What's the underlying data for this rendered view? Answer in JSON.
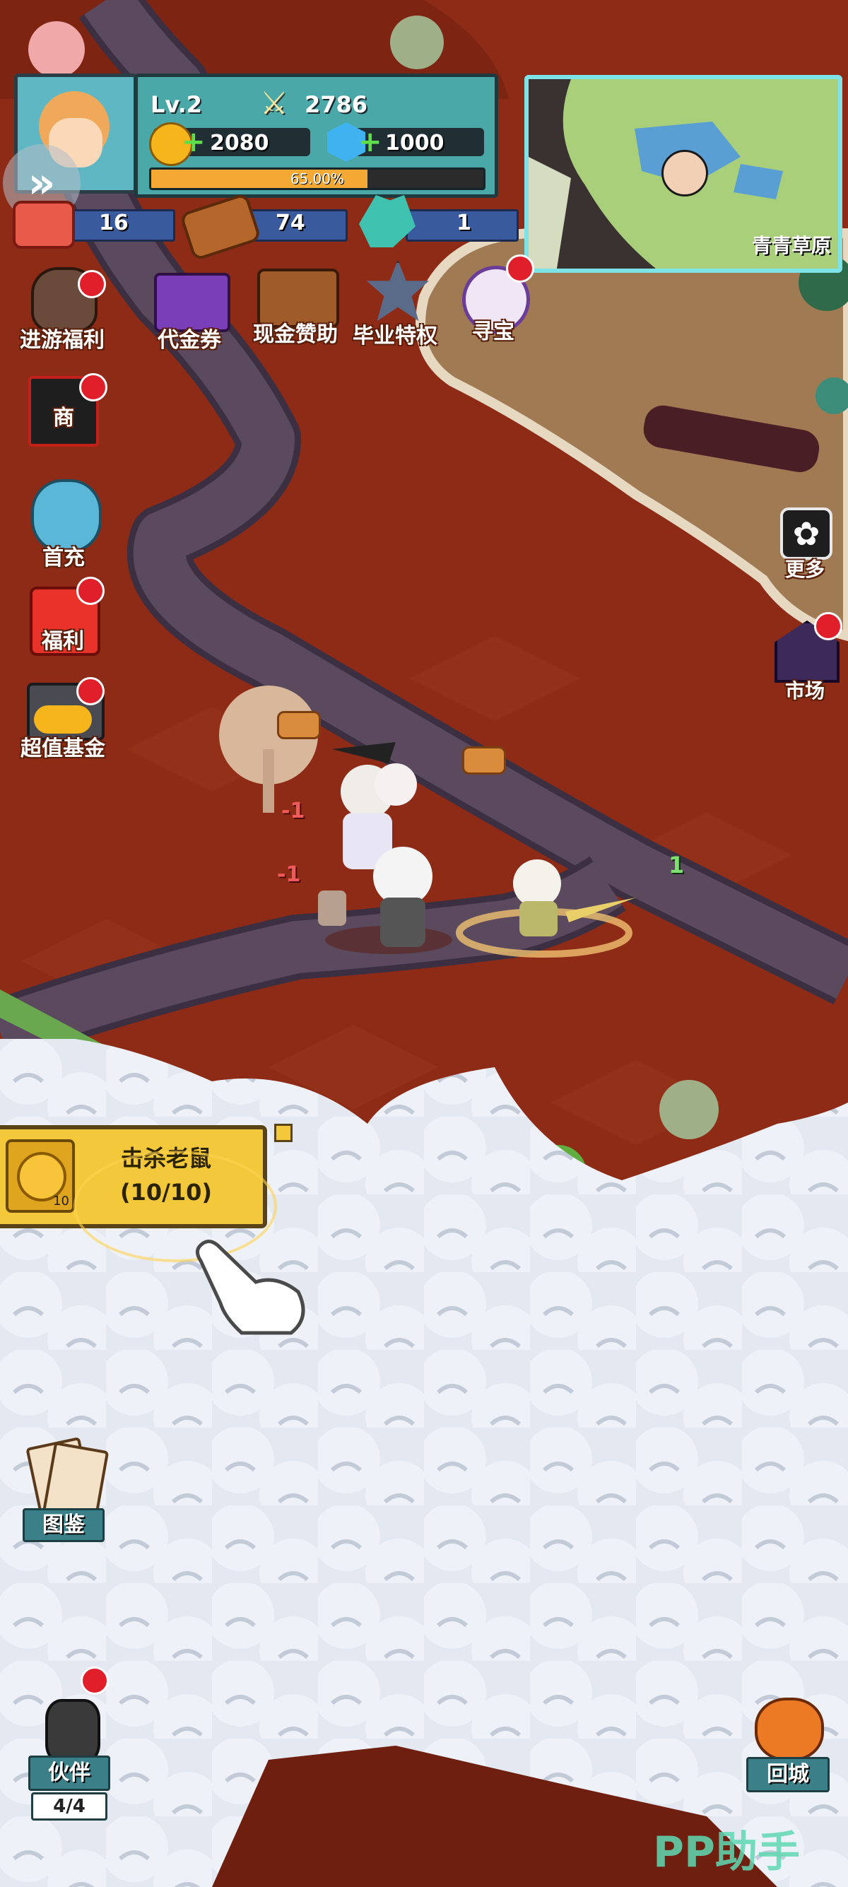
{
  "player": {
    "level": "Lv.2",
    "combat_power": "2786",
    "gold": "2080",
    "gems": "1000",
    "exp_percent_label": "65.00%",
    "exp_fraction": 0.65
  },
  "resources": {
    "stone": "16",
    "wood": "74",
    "crystal": "1"
  },
  "minimap": {
    "area_name": "青青草原"
  },
  "top_menu": [
    {
      "label": "代金券",
      "icon": "voucher-gems-icon"
    },
    {
      "label": "现金赞助",
      "icon": "treasure-chest-icon"
    },
    {
      "label": "毕业特权",
      "icon": "graduation-badge-icon"
    },
    {
      "label": "寻宝",
      "icon": "treasure-hunt-wheel-icon"
    }
  ],
  "left_menu": [
    {
      "label": "进游福利",
      "icon": "lucky-bag-icon"
    },
    {
      "label": "商",
      "icon": "gift-box-icon"
    },
    {
      "label": "首充",
      "icon": "first-recharge-hero-icon"
    },
    {
      "label": "福利",
      "icon": "red-envelope-icon"
    },
    {
      "label": "超值基金",
      "icon": "gold-coins-chest-icon"
    }
  ],
  "right_menu": [
    {
      "label": "更多",
      "icon": "more-gear-icon"
    },
    {
      "label": "市场",
      "icon": "market-house-icon"
    }
  ],
  "quest": {
    "title": "击杀老鼠",
    "progress": "(10/10)",
    "reward_count": "10"
  },
  "bottom_left": {
    "codex_label": "图鉴",
    "partner_label": "伙伴",
    "partner_count": "4/4"
  },
  "bottom_right": {
    "return_label": "回城"
  },
  "combat": {
    "damage_1": "-1",
    "damage_2": "-1",
    "heal_label": "1"
  },
  "watermark": "PP助手",
  "colors": {
    "ground": "#8d2b16",
    "road": "#5b4a5e",
    "panel": "#4aa9a8",
    "quest": "#f3c93b",
    "red_dot": "#e11f2a"
  }
}
